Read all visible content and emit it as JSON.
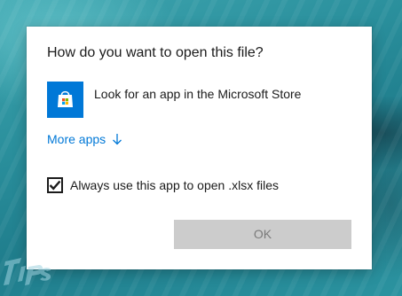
{
  "dialog": {
    "title": "How do you want to open this file?",
    "store_option": {
      "label": "Look for an app in the Microsoft Store",
      "icon": "microsoft-store-icon"
    },
    "more_apps": {
      "label": "More apps",
      "icon": "arrow-down-icon"
    },
    "always_use": {
      "label": "Always use this app to open .xlsx files",
      "checked": true
    },
    "ok_button": {
      "label": "OK",
      "enabled": false
    }
  },
  "colors": {
    "accent": "#0078d7",
    "disabled_button": "#cccccc",
    "disabled_text": "#7a7a7a",
    "background_water": "#2a8f9c"
  },
  "watermark": {
    "icon": "tips-logo-watermark"
  }
}
